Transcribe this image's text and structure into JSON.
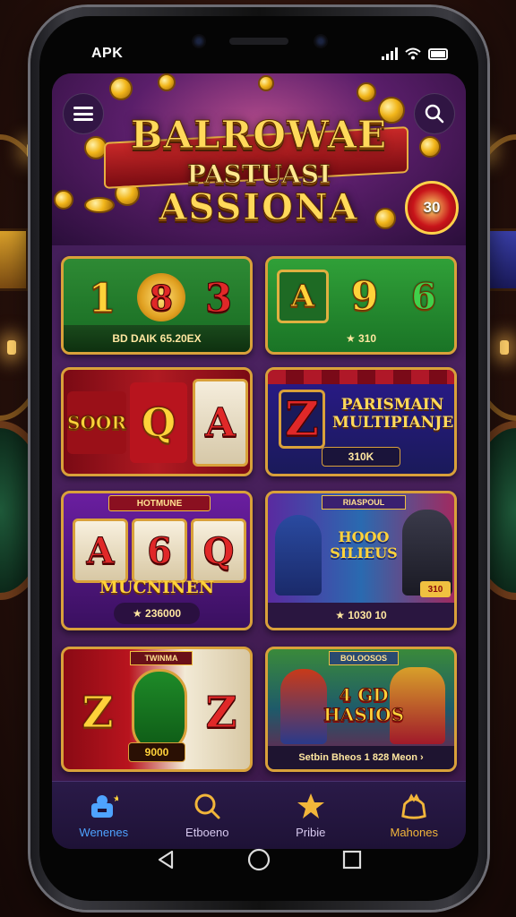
{
  "status": {
    "left_label": "APK"
  },
  "hero": {
    "line1": "BALROWAE",
    "line2": "PASTUASI",
    "line3": "ASSIONA",
    "badge": "30"
  },
  "cards": [
    {
      "id": "card-1",
      "symbols": [
        "1",
        "8",
        "3"
      ],
      "caption": "BD DAIK 65.20EX"
    },
    {
      "id": "card-2",
      "symbols": [
        "A",
        "9",
        "6"
      ],
      "caption": "★ 310"
    },
    {
      "id": "card-3",
      "symbols": [
        "SOOR",
        "Q",
        "A"
      ],
      "caption": ""
    },
    {
      "id": "card-4",
      "symbols": [
        "Z"
      ],
      "title": "PARISMAIN MULTIPIANJEN",
      "caption": "310K"
    },
    {
      "id": "card-5",
      "banner": "HOTMUNE",
      "symbols": [
        "A",
        "6",
        "Q"
      ],
      "title": "MUCNINEN",
      "caption": "★ 236000"
    },
    {
      "id": "card-6",
      "banner": "RIASPOUL",
      "title": "HOOO SILIEUS",
      "badge": "310",
      "caption": "★ 1030 10"
    },
    {
      "id": "card-7",
      "banner": "TWINMA",
      "symbols": [
        "Z",
        "Z"
      ],
      "caption": "9000"
    },
    {
      "id": "card-8",
      "banner": "BOLOOSOS",
      "title": "4 GD HASIOS",
      "caption": "Setbin Bheos 1 828 Meon ›"
    }
  ],
  "bottom_nav": [
    {
      "label": "Wenenes",
      "icon": "home-icon",
      "color": "#4ea3ff"
    },
    {
      "label": "Etboeno",
      "icon": "search-icon",
      "color": "#d7c9ef"
    },
    {
      "label": "Pribie",
      "icon": "star-icon",
      "color": "#d7c9ef"
    },
    {
      "label": "Mahones",
      "icon": "crown-bag-icon",
      "color": "#f2b63a"
    }
  ],
  "colors": {
    "accent_gold": "#d9a13a",
    "nav_active": "#4ea3ff",
    "nav_highlight": "#f2b63a"
  }
}
